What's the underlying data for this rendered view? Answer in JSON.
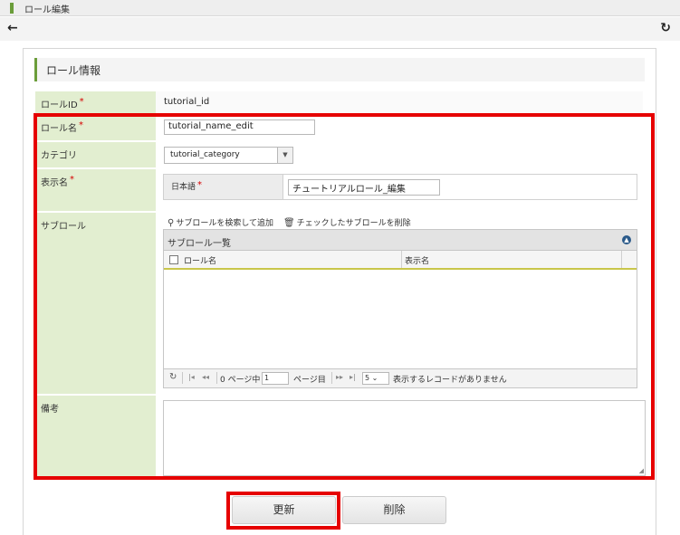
{
  "window": {
    "title": "ロール編集"
  },
  "toolbar": {
    "back_icon": "←",
    "reload_icon": "↻"
  },
  "section": {
    "title": "ロール情報"
  },
  "fields": {
    "role_id": {
      "label": "ロールID",
      "value": "tutorial_id"
    },
    "role_name": {
      "label": "ロール名",
      "value": "tutorial_name_edit"
    },
    "category": {
      "label": "カテゴリ",
      "value": "tutorial_category",
      "arrow": "▼"
    },
    "display_name": {
      "label": "表示名",
      "lang_label": "日本語",
      "value": "チュートリアルロール_編集"
    },
    "sub_role": {
      "label": "サブロール"
    },
    "remarks": {
      "label": "備考",
      "value": ""
    },
    "required_mark": "*"
  },
  "subrole": {
    "search_add": "サブロールを検索して追加",
    "delete_checked": "チェックしたサブロールを削除",
    "grid_title": "サブロール一覧",
    "columns": [
      "ロール名",
      "表示名"
    ],
    "pager": {
      "page_prefix": "0 ページ中",
      "page_value": "1",
      "page_suffix": "ページ目",
      "rows_value": "5",
      "no_records": "表示するレコードがありません"
    }
  },
  "buttons": {
    "update": "更新",
    "delete": "削除"
  },
  "colors": {
    "accent": "#6b9d3a",
    "label_bg": "#e2eed0",
    "highlight": "#e60000"
  }
}
